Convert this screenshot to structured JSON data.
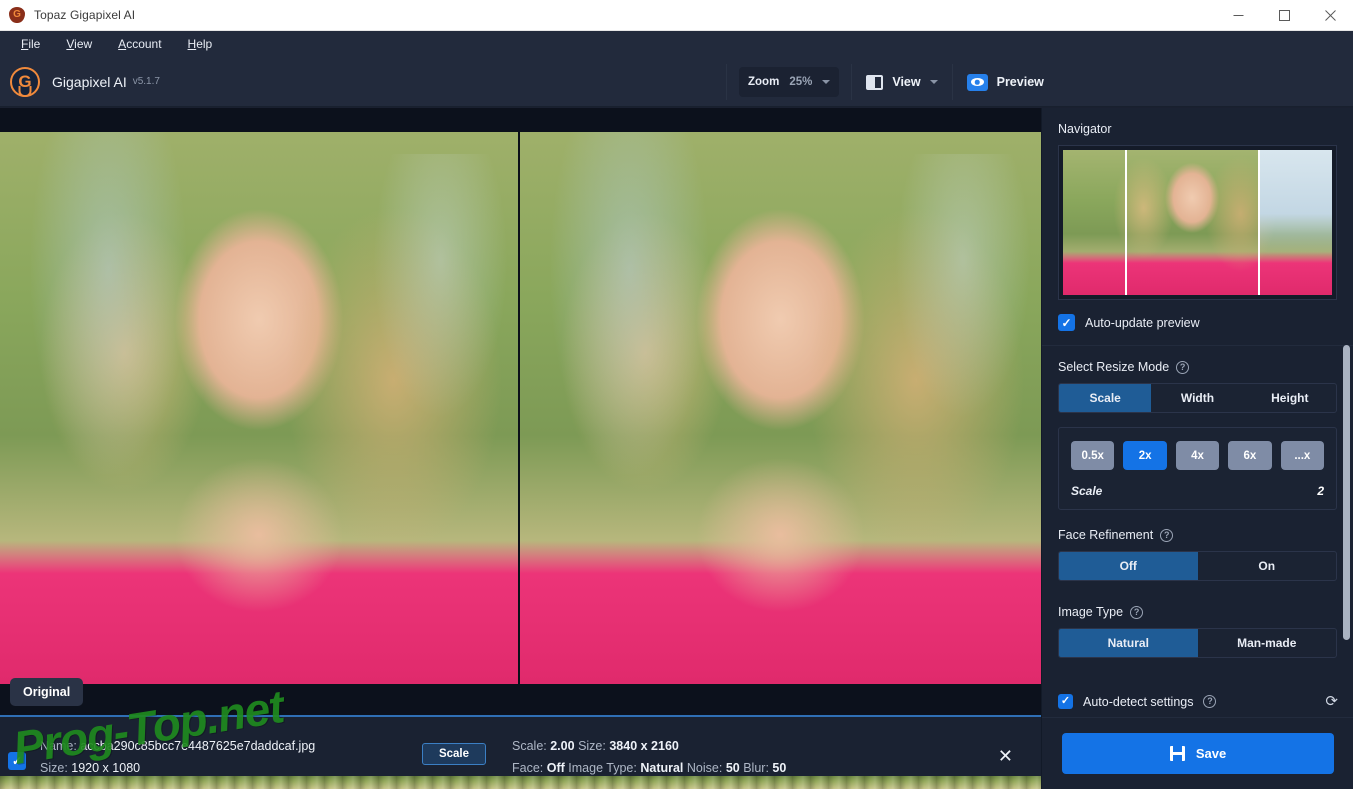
{
  "window": {
    "title": "Topaz Gigapixel AI",
    "app_icon": "gigapixel-logo-icon",
    "minimize": "minimize-icon",
    "maximize": "maximize-icon",
    "close": "close-icon"
  },
  "menubar": {
    "items": [
      {
        "label": "File",
        "mnemonic": "F"
      },
      {
        "label": "View",
        "mnemonic": "V"
      },
      {
        "label": "Account",
        "mnemonic": "A"
      },
      {
        "label": "Help",
        "mnemonic": "H"
      }
    ]
  },
  "header": {
    "brand_letter": "G",
    "brand_name": "Gigapixel AI",
    "version": "v5.1.7",
    "zoom": {
      "label": "Zoom",
      "value": "25%",
      "caret": "chevron-down-icon"
    },
    "view": {
      "label": "View",
      "icon": "split-view-icon",
      "caret": "chevron-down-icon"
    },
    "preview": {
      "label": "Preview",
      "icon": "eye-icon"
    }
  },
  "canvas": {
    "original_badge": "Original"
  },
  "sidebar": {
    "navigator": {
      "title": "Navigator"
    },
    "auto_update_preview": {
      "label": "Auto-update preview",
      "checked": true,
      "check_glyph": "✓"
    },
    "resize_mode": {
      "title": "Select Resize Mode",
      "help": "help-icon",
      "options": [
        "Scale",
        "Width",
        "Height"
      ],
      "selected": "Scale"
    },
    "scale_presets": {
      "options": [
        "0.5x",
        "2x",
        "4x",
        "6x",
        "...x"
      ],
      "selected": "2x",
      "row_label": "Scale",
      "row_value": "2"
    },
    "face_refinement": {
      "title": "Face Refinement",
      "help": "help-icon",
      "options": [
        "Off",
        "On"
      ],
      "selected": "Off"
    },
    "image_type": {
      "title": "Image Type",
      "help": "help-icon",
      "options": [
        "Natural",
        "Man-made"
      ],
      "selected": "Natural"
    },
    "auto_detect": {
      "label": "Auto-detect settings",
      "checked": true,
      "check_glyph": "✓",
      "help": "help-icon",
      "reset_icon": "refresh-icon"
    },
    "save_button": {
      "label": "Save",
      "icon": "save-floppy-icon"
    }
  },
  "bottom_bar": {
    "selected": true,
    "check_glyph": "✓",
    "name_label": "Name:",
    "name_value": "accba290c85bcc7e4487625e7daddcaf.jpg",
    "size_label": "Size:",
    "size_value": "1920 x 1080",
    "scale_button": "Scale",
    "settings": {
      "scale_label": "Scale:",
      "scale_value": "2.00",
      "size_label": "Size:",
      "size_value": "3840 x 2160",
      "face_label": "Face:",
      "face_value": "Off",
      "image_type_label": "Image Type:",
      "image_type_value": "Natural",
      "noise_label": "Noise:",
      "noise_value": "50",
      "blur_label": "Blur:",
      "blur_value": "50"
    },
    "close_glyph": "✕"
  },
  "watermark": {
    "text": "Prog-Top.net",
    "color": "#1f8a1f"
  },
  "colors": {
    "accent_blue": "#1473e6",
    "panel_bg": "#1a2232",
    "header_bg": "#222a3c",
    "canvas_bg": "#0c111c",
    "selected_segment": "#1f5c96",
    "scale_button": "#7f8ca6"
  }
}
